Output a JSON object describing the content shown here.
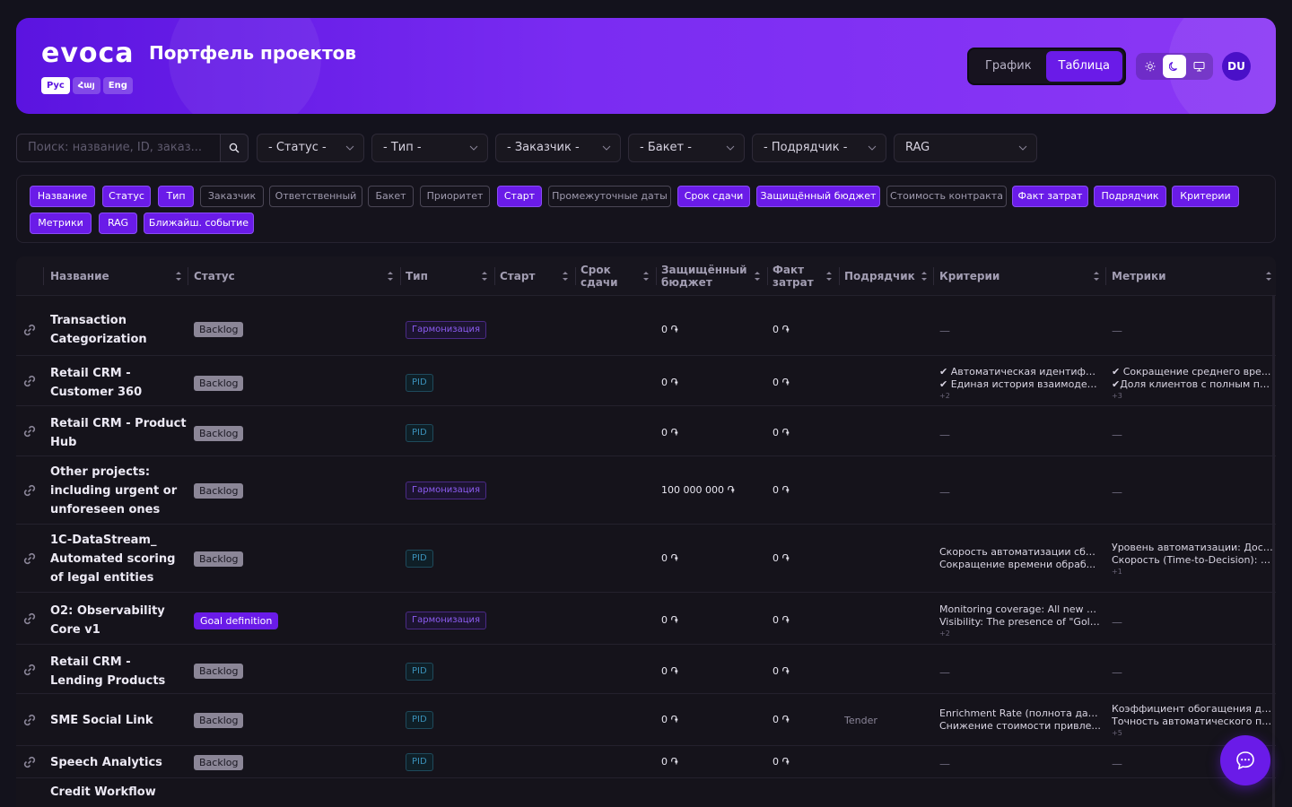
{
  "header": {
    "logo": "evoca",
    "title": "Портфель проектов",
    "languages": [
      {
        "label": "Рус",
        "active": true
      },
      {
        "label": "Հայ",
        "active": false
      },
      {
        "label": "Eng",
        "active": false
      }
    ],
    "view_toggle": [
      {
        "label": "График",
        "active": false
      },
      {
        "label": "Таблица",
        "active": true
      }
    ],
    "theme_icons": [
      "sun-icon",
      "moon-icon",
      "monitor-icon"
    ],
    "active_theme": "moon-icon",
    "avatar": "DU"
  },
  "filters": {
    "search_placeholder": "Поиск: название, ID, заказ...",
    "selects": [
      "- Статус -",
      "- Тип -",
      "- Заказчик -",
      "- Бакет -",
      "- Подрядчик -",
      "RAG"
    ]
  },
  "column_chips": [
    {
      "label": "Название",
      "on": true
    },
    {
      "label": "Статус",
      "on": true
    },
    {
      "label": "Тип",
      "on": true
    },
    {
      "label": "Заказчик",
      "on": false
    },
    {
      "label": "Ответственный",
      "on": false
    },
    {
      "label": "Бакет",
      "on": false
    },
    {
      "label": "Приоритет",
      "on": false
    },
    {
      "label": "Старт",
      "on": true
    },
    {
      "label": "Промежуточные даты",
      "on": false
    },
    {
      "label": "Срок сдачи",
      "on": true
    },
    {
      "label": "Защищённый бюджет",
      "on": true
    },
    {
      "label": "Стоимость контракта",
      "on": false
    },
    {
      "label": "Факт затрат",
      "on": true
    },
    {
      "label": "Подрядчик",
      "on": true
    },
    {
      "label": "Критерии",
      "on": true
    },
    {
      "label": "Метрики",
      "on": true
    },
    {
      "label": "RAG",
      "on": true
    },
    {
      "label": "Ближайш. событие",
      "on": true
    }
  ],
  "table": {
    "columns": [
      {
        "label": "Название"
      },
      {
        "label": "Статус"
      },
      {
        "label": "Тип"
      },
      {
        "label": "Старт"
      },
      {
        "label": "Срок сдачи"
      },
      {
        "label": "Защищённый бюджет"
      },
      {
        "label": "Факт затрат"
      },
      {
        "label": "Подрядчик"
      },
      {
        "label": "Критерии"
      },
      {
        "label": "Метрики"
      }
    ],
    "rows": [
      {
        "name": "Transaction Categorization",
        "status": "Backlog",
        "type": "Гармонизация",
        "budget": "0 ֏",
        "fact": "0 ֏",
        "contractor": "",
        "criteria": [],
        "criteria_more": "",
        "metrics": [],
        "metrics_more": ""
      },
      {
        "name": "Retail CRM - Customer 360",
        "status": "Backlog",
        "type": "PID",
        "budget": "0 ֏",
        "fact": "0 ֏",
        "contractor": "",
        "criteria": [
          "✔ Автоматическая идентифи...",
          "✔ Единая история взаимодей..."
        ],
        "criteria_more": "+2",
        "metrics": [
          "✔ Сокращение среднего вре...",
          "✔Доля клиентов с полным пр..."
        ],
        "metrics_more": "+3"
      },
      {
        "name": "Retail CRM - Product Hub",
        "status": "Backlog",
        "type": "PID",
        "budget": "0 ֏",
        "fact": "0 ֏",
        "contractor": "",
        "criteria": [],
        "criteria_more": "",
        "metrics": [],
        "metrics_more": ""
      },
      {
        "name": "Other projects: including urgent or unforeseen ones",
        "status": "Backlog",
        "type": "Гармонизация",
        "budget": "100 000 000 ֏",
        "fact": "0 ֏",
        "contractor": "",
        "criteria": [],
        "criteria_more": "",
        "metrics": [],
        "metrics_more": ""
      },
      {
        "name": "1C-DataStream_ Automated scoring of legal entities",
        "status": "Backlog",
        "type": "PID",
        "budget": "0 ֏",
        "fact": "0 ֏",
        "contractor": "",
        "criteria": [
          "Скорость автоматизации сбо...",
          "Сокращение времени обраб..."
        ],
        "criteria_more": "",
        "metrics": [
          "Уровень автоматизации: Дост...",
          "Скорость (Time-to-Decision): С..."
        ],
        "metrics_more": "+1"
      },
      {
        "name": "O2: Observability Core v1",
        "status": "Goal definition",
        "type": "Гармонизация",
        "budget": "0 ֏",
        "fact": "0 ֏",
        "contractor": "",
        "criteria": [
          "Monitoring coverage: All new A...",
          "Visibility: The presence of \"Gold..."
        ],
        "criteria_more": "+2",
        "metrics": [],
        "metrics_more": ""
      },
      {
        "name": "Retail CRM - Lending Products",
        "status": "Backlog",
        "type": "PID",
        "budget": "0 ֏",
        "fact": "0 ֏",
        "contractor": "",
        "criteria": [],
        "criteria_more": "",
        "metrics": [],
        "metrics_more": ""
      },
      {
        "name": "SME Social Link",
        "status": "Backlog",
        "type": "PID",
        "budget": "0 ֏",
        "fact": "0 ֏",
        "contractor": "Tender",
        "criteria": [
          "Enrichment Rate (полнота дан...",
          "Снижение стоимости привле..."
        ],
        "criteria_more": "",
        "metrics": [
          "Коэффициент обогащения да...",
          "Точность автоматического по..."
        ],
        "metrics_more": "+5"
      },
      {
        "name": "Speech Analytics",
        "status": "Backlog",
        "type": "PID",
        "budget": "0 ֏",
        "fact": "0 ֏",
        "contractor": "",
        "criteria": [],
        "criteria_more": "",
        "metrics": [],
        "metrics_more": ""
      },
      {
        "name": "Credit Workflow",
        "status": "",
        "type": "",
        "budget": "",
        "fact": "",
        "contractor": "",
        "criteria": [],
        "criteria_more": "",
        "metrics": [],
        "metrics_more": ""
      }
    ],
    "empty_value": "—"
  },
  "chat_button_icon": "chat-icon"
}
